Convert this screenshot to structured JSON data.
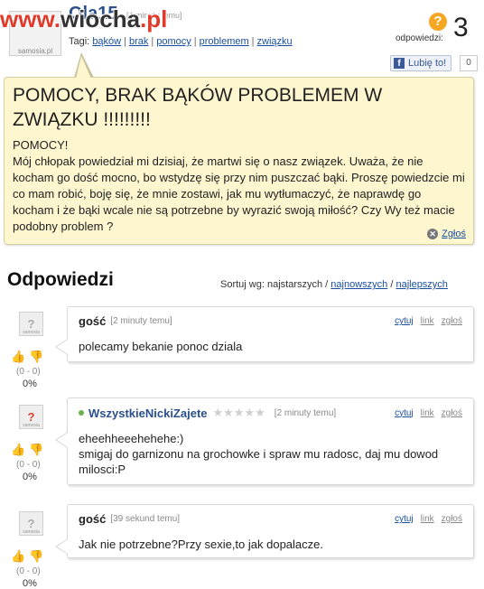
{
  "header": {
    "watermark_part1": "www.",
    "watermark_part2": "wiocha",
    "watermark_part3": ".pl",
    "author": "Ola15",
    "time": "[4 minuty temu]",
    "tags_label": "Tagi:",
    "tags": [
      "bąków",
      "brak",
      "pomocy",
      "problemem",
      "związku"
    ],
    "answers_badge": "?",
    "answers_label": "odpowiedzi:",
    "answers_count": "3",
    "like_label": "Lubię to!",
    "like_count": "0",
    "avatar_text": "samosia.pl"
  },
  "question": {
    "title": "POMOCY, BRAK BĄKÓW PROBLEMEM W ZWIĄZKU !!!!!!!!!",
    "body_lines": [
      "POMOCY!",
      "Mój chłopak powiedział mi dzisiaj, że martwi się o nasz związek. Uważa, że nie kocham go dość mocno, bo wstydzę się przy nim puszczać bąki. Proszę powiedzcie mi co mam robić, boję się, że mnie zostawi, jak mu wytłumaczyć, że naprawdę go kocham i że bąki wcale nie są potrzebne by wyrazić swoją miłość? Czy Wy też macie podobny problem ?"
    ],
    "report_label": "Zgłoś"
  },
  "answers_section": {
    "title": "Odpowiedzi",
    "sort_label": "Sortuj wg:",
    "sort_current": "najstarszych",
    "sort_options": [
      "najnowszych",
      "najlepszych"
    ]
  },
  "answers": [
    {
      "author": "gość",
      "time": "[2 minuty temu]",
      "text_lines": [
        "polecamy bekanie ponoc dziala"
      ],
      "score": "(0 - 0)",
      "pct": "0%",
      "links": [
        "cytuj",
        "link",
        "zgłoś"
      ]
    },
    {
      "author": "WszystkieNickiZajete",
      "time": "[2 minuty temu]",
      "rating_stars": "★★★★★",
      "text_lines": [
        "eheehheeehehehe:)",
        "smigaj do garnizonu na grochowke i spraw mu radosc, daj mu dowod milosci:P"
      ],
      "score": "(0 - 0)",
      "pct": "0%",
      "links": [
        "cytuj",
        "link",
        "zgłoś"
      ]
    },
    {
      "author": "gość",
      "time": "[39 sekund temu]",
      "text_lines": [
        "Jak nie potrzebne?Przy sexie,to jak dopalacze."
      ],
      "score": "(0 - 0)",
      "pct": "0%",
      "links": [
        "cytuj",
        "link",
        "zgłoś"
      ]
    }
  ],
  "icons": {
    "thumb_up": "thumb-up-icon",
    "thumb_down": "thumb-down-icon",
    "facebook": "facebook-icon",
    "report": "close-icon",
    "question": "question-icon"
  },
  "colors": {
    "question_bg": "#fdf6cf",
    "link": "#1a4fa0",
    "badge": "#f5a623",
    "watermark": "#e23a2a"
  }
}
